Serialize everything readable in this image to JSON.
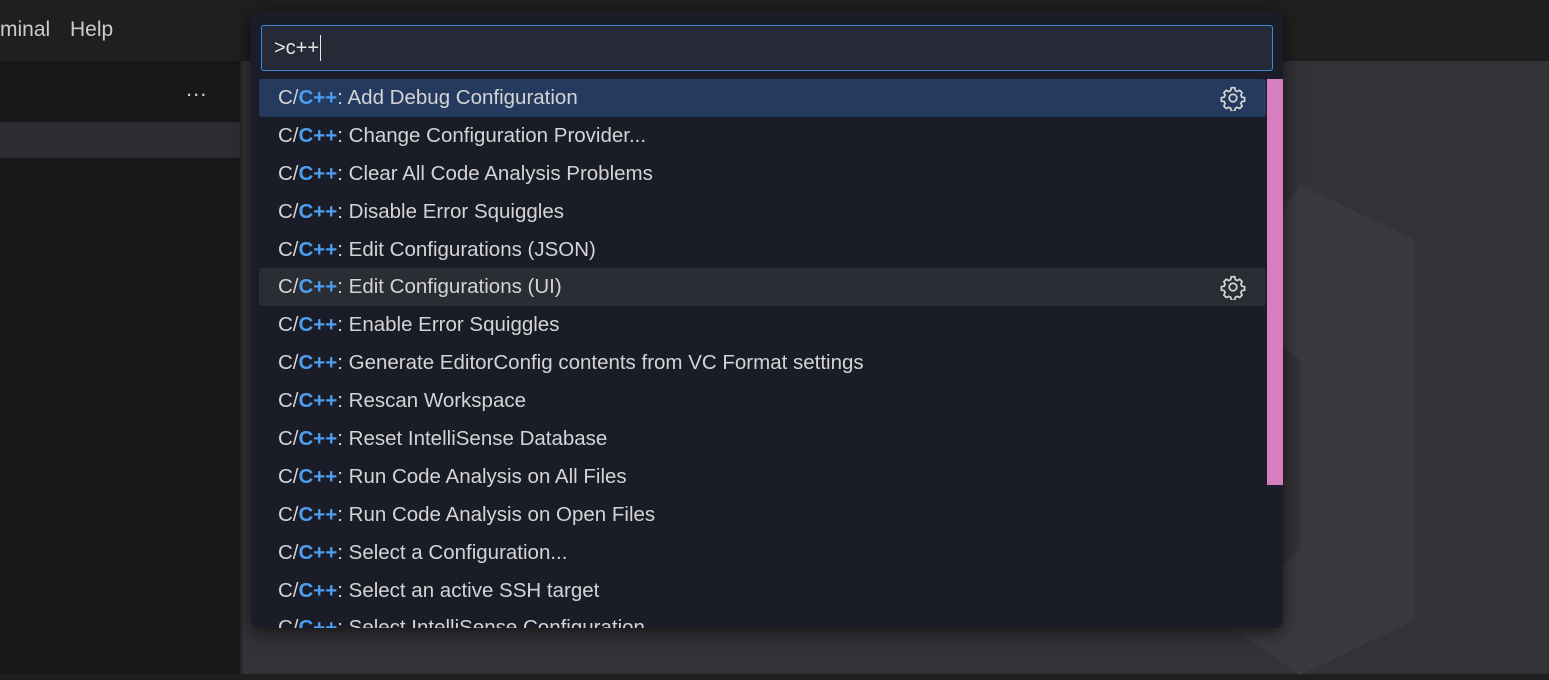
{
  "menu": {
    "terminal": "minal",
    "help": "Help"
  },
  "sidebar": {
    "more_label": "..."
  },
  "palette": {
    "query": ">c++",
    "items": [
      {
        "prefix": "C/",
        "match": "C++",
        "rest": ": Add Debug Configuration",
        "gear": true
      },
      {
        "prefix": "C/",
        "match": "C++",
        "rest": ": Change Configuration Provider...",
        "gear": false
      },
      {
        "prefix": "C/",
        "match": "C++",
        "rest": ": Clear All Code Analysis Problems",
        "gear": false
      },
      {
        "prefix": "C/",
        "match": "C++",
        "rest": ": Disable Error Squiggles",
        "gear": false
      },
      {
        "prefix": "C/",
        "match": "C++",
        "rest": ": Edit Configurations (JSON)",
        "gear": false
      },
      {
        "prefix": "C/",
        "match": "C++",
        "rest": ": Edit Configurations (UI)",
        "gear": true
      },
      {
        "prefix": "C/",
        "match": "C++",
        "rest": ": Enable Error Squiggles",
        "gear": false
      },
      {
        "prefix": "C/",
        "match": "C++",
        "rest": ": Generate EditorConfig contents from VC Format settings",
        "gear": false
      },
      {
        "prefix": "C/",
        "match": "C++",
        "rest": ": Rescan Workspace",
        "gear": false
      },
      {
        "prefix": "C/",
        "match": "C++",
        "rest": ": Reset IntelliSense Database",
        "gear": false
      },
      {
        "prefix": "C/",
        "match": "C++",
        "rest": ": Run Code Analysis on All Files",
        "gear": false
      },
      {
        "prefix": "C/",
        "match": "C++",
        "rest": ": Run Code Analysis on Open Files",
        "gear": false
      },
      {
        "prefix": "C/",
        "match": "C++",
        "rest": ": Select a Configuration...",
        "gear": false
      },
      {
        "prefix": "C/",
        "match": "C++",
        "rest": ": Select an active SSH target",
        "gear": false
      },
      {
        "prefix": "C/",
        "match": "C++",
        "rest": ": Select IntelliSense Configuration...",
        "gear": false
      }
    ]
  },
  "colors": {
    "accent": "#3f8bd6",
    "highlight": "#4d9df0",
    "selected_row": "#243a5e",
    "scrollbar": "#d77ec0"
  },
  "icons": {
    "gear": "gear-icon",
    "more": "ellipsis-icon"
  }
}
